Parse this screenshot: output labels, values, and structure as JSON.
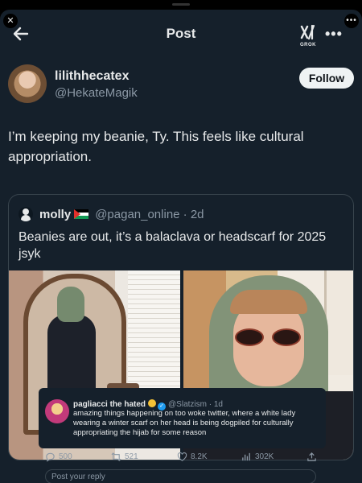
{
  "header": {
    "title": "Post",
    "grok_label": "GROK",
    "more": "•••"
  },
  "corners": {
    "close": "✕",
    "more": "•••"
  },
  "post": {
    "display_name": "lilithhecatex",
    "handle": "@HekateMagik",
    "follow_label": "Follow",
    "text": "I’m keeping my beanie, Ty. This feels like cultural appropriation."
  },
  "quote": {
    "display_name": "molly",
    "handle_time": "@pagan_online · 2d",
    "text": "Beanies are out, it’s a balaclava or headscarf for 2025 jsyk"
  },
  "overlay": {
    "name": "pagliacci the hated",
    "handle_time": "@Slatzism · 1d",
    "text": "amazing things happening on too woke twitter, where a white lady wearing a winter scarf on her head is being dogpiled for culturally appropriating the hijab for some reason"
  },
  "actions": {
    "replies": "500",
    "reposts": "521",
    "likes": "8.2K",
    "views": "302K"
  },
  "reply": {
    "placeholder": "Post your reply"
  },
  "colors": {
    "background": "#15202b",
    "border": "#38444d",
    "muted": "#8b98a5",
    "verified": "#1d9bf0"
  }
}
